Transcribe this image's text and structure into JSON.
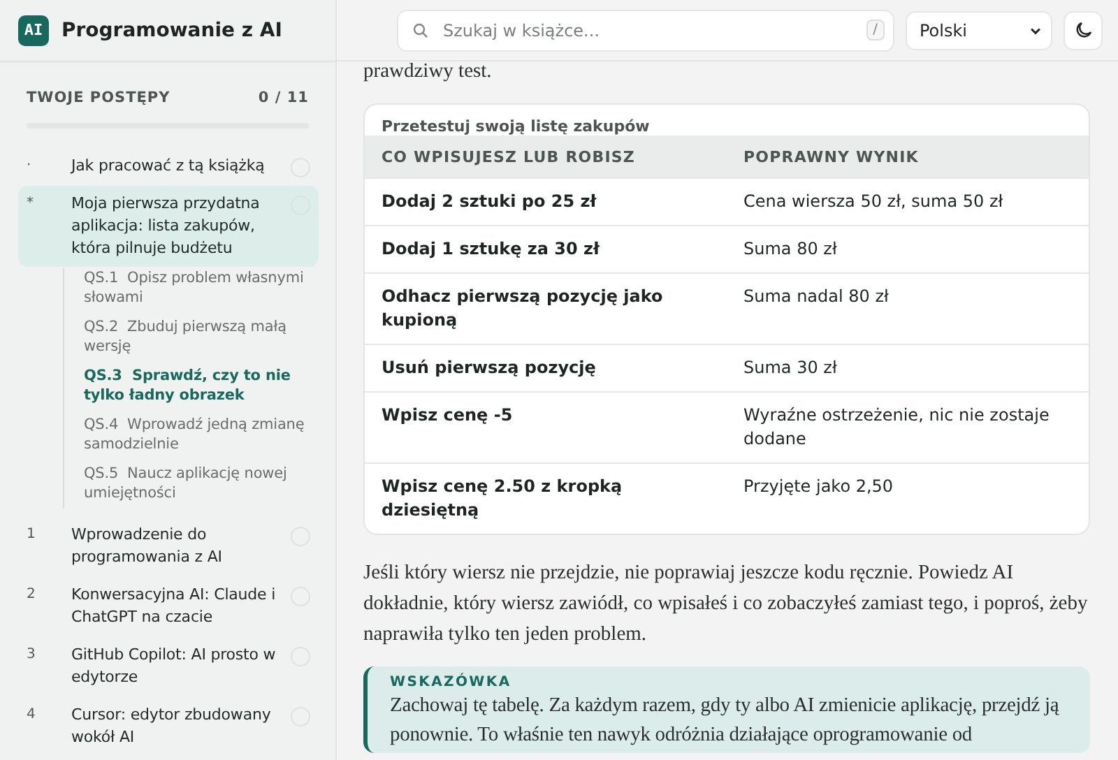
{
  "brand": {
    "logo": "AI",
    "title": "Programowanie z AI"
  },
  "search": {
    "placeholder": "Szukaj w książce...",
    "shortcut": "/"
  },
  "language": {
    "value": "Polski"
  },
  "progress": {
    "label": "TWOJE POSTĘPY",
    "count": "0 / 11",
    "level": 0
  },
  "chapters": [
    {
      "marker": "·",
      "title": "Jak pracować z tą książką",
      "selected": false
    },
    {
      "marker": "*",
      "title": "Moja pierwsza przydatna aplikacja: lista zakupów, która pilnuje budżetu",
      "selected": true,
      "children": [
        {
          "number": "QS.1",
          "title": "Opisz problem własnymi słowami",
          "selected": false
        },
        {
          "number": "QS.2",
          "title": "Zbuduj pierwszą małą wersję",
          "selected": false
        },
        {
          "number": "QS.3",
          "title": "Sprawdź, czy to nie tylko ładny obrazek",
          "selected": true
        },
        {
          "number": "QS.4",
          "title": "Wprowadź jedną zmianę samodzielnie",
          "selected": false
        },
        {
          "number": "QS.5",
          "title": "Naucz aplikację nowej umiejętności",
          "selected": false
        }
      ]
    },
    {
      "marker": "1",
      "title": "Wprowadzenie do programowania z AI",
      "selected": false
    },
    {
      "marker": "2",
      "title": "Konwersacyjna AI: Claude i ChatGPT na czacie",
      "selected": false
    },
    {
      "marker": "3",
      "title": "GitHub Copilot: AI prosto w edytorze",
      "selected": false
    },
    {
      "marker": "4",
      "title": "Cursor: edytor zbudowany wokół AI",
      "selected": false
    }
  ],
  "intro_text": "prawdziwy test.",
  "table": {
    "caption": "Przetestuj swoją listę zakupów",
    "columns": [
      "CO WPISUJESZ LUB ROBISZ",
      "POPRAWNY WYNIK"
    ],
    "rows": [
      [
        "Dodaj 2 sztuki po 25 zł",
        "Cena wiersza 50 zł, suma 50 zł"
      ],
      [
        "Dodaj 1 sztukę za 30 zł",
        "Suma 80 zł"
      ],
      [
        "Odhacz pierwszą pozycję jako kupioną",
        "Suma nadal 80 zł"
      ],
      [
        "Usuń pierwszą pozycję",
        "Suma 30 zł"
      ],
      [
        "Wpisz cenę -5",
        "Wyraźne ostrzeżenie, nic nie zostaje dodane"
      ],
      [
        "Wpisz cenę 2.50 z kropką dziesiętną",
        "Przyjęte jako 2,50"
      ]
    ]
  },
  "paragraph": "Jeśli który wiersz nie przejdzie, nie poprawiaj jeszcze kodu ręcznie. Powiedz AI dokładnie, który wiersz zawiódł, co wpisałeś i co zobaczyłeś zamiast tego, i poproś, żeby naprawiła tylko ten jeden problem.",
  "tip": {
    "label": "WSKAZÓWKA",
    "text": "Zachowaj tę tabelę. Za każdym razem, gdy ty albo AI zmienicie aplikację, przejdź ją ponownie. To właśnie ten nawyk odróżnia działające oprogramowanie od"
  }
}
